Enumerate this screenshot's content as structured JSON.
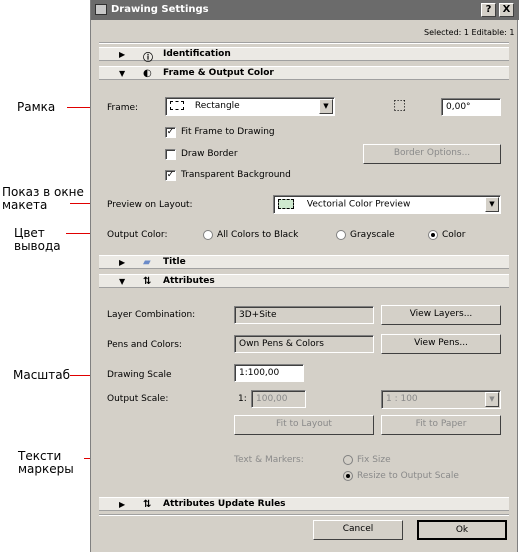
{
  "annotations": {
    "frame": "Рамка",
    "preview": "Показ в окне\nмакета",
    "output_color": "Цвет\nвывода",
    "scale": "Масштаб",
    "text_markers": "Тексти\nмаркеры"
  },
  "window": {
    "title": "Drawing Settings",
    "help_button": "?",
    "close_button": "X"
  },
  "header": {
    "selected": "Selected: 1 Editable: 1"
  },
  "sections": {
    "identification": "Identification",
    "frame_output": "Frame & Output Color",
    "title": "Title",
    "attributes": "Attributes",
    "attributes_update": "Attributes Update Rules"
  },
  "frame": {
    "label": "Frame:",
    "value": "Rectangle",
    "angle": "0,00°",
    "fit_frame": "Fit Frame to Drawing",
    "draw_border": "Draw Border",
    "border_options": "Border Options...",
    "transparent_bg": "Transparent Background",
    "checks": {
      "fit_frame": true,
      "draw_border": false,
      "transparent_bg": true
    }
  },
  "preview": {
    "label": "Preview on Layout:",
    "value": "Vectorial Color Preview"
  },
  "output_color": {
    "label": "Output Color:",
    "options": [
      "All Colors to Black",
      "Grayscale",
      "Color"
    ],
    "selected": "Color"
  },
  "attributes": {
    "layer_label": "Layer Combination:",
    "layer_value": "3D+Site",
    "view_layers": "View Layers...",
    "pen_label": "Pens and Colors:",
    "pen_value": "Own Pens & Colors",
    "view_pens": "View Pens...",
    "drawing_scale_label": "Drawing Scale",
    "drawing_scale_value": "1:100,00",
    "output_scale_label": "Output Scale:",
    "output_scale_prefix": "1:",
    "output_scale_value": "100,00",
    "output_scale_select": "1 : 100",
    "fit_layout": "Fit to Layout",
    "fit_paper": "Fit to Paper",
    "text_markers_label": "Text & Markers:",
    "fix_size": "Fix Size",
    "resize": "Resize to Output Scale"
  },
  "footer": {
    "cancel": "Cancel",
    "ok": "Ok"
  }
}
